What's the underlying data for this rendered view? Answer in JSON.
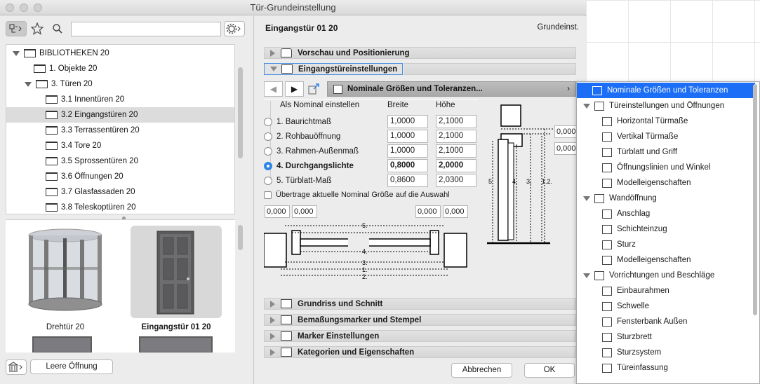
{
  "window": {
    "title": "Tür-Grundeinstellung"
  },
  "toolbar": {
    "search_value": ""
  },
  "tree": [
    {
      "label": "BIBLIOTHEKEN 20",
      "level": 0,
      "expanded": true
    },
    {
      "label": "1. Objekte 20",
      "level": 1
    },
    {
      "label": "3. Türen 20",
      "level": 1,
      "expanded": true
    },
    {
      "label": "3.1 Innentüren 20",
      "level": 2
    },
    {
      "label": "3.2 Eingangstüren 20",
      "level": 2,
      "selected": true
    },
    {
      "label": "3.3 Terrassentüren 20",
      "level": 2
    },
    {
      "label": "3.4 Tore 20",
      "level": 2
    },
    {
      "label": "3.5 Sprossentüren 20",
      "level": 2
    },
    {
      "label": "3.6 Öffnungen 20",
      "level": 2
    },
    {
      "label": "3.7 Glasfassaden 20",
      "level": 2
    },
    {
      "label": "3.8 Teleskoptüren 20",
      "level": 2
    }
  ],
  "thumbs": [
    {
      "label": "Drehtür 20",
      "selected": false
    },
    {
      "label": "Eingangstür 01 20",
      "selected": true
    }
  ],
  "bottom_left": {
    "button": "Leere Öffnung"
  },
  "header": {
    "title": "Eingangstür 01 20",
    "right": "Grundeinst."
  },
  "sections_top": [
    {
      "label": "Vorschau und Positionierung",
      "open": false
    },
    {
      "label": "Eingangstüreinstellungen",
      "open": true
    }
  ],
  "combo": {
    "label": "Nominale Größen und Toleranzen..."
  },
  "nominal": {
    "heading": "Als Nominal einstellen",
    "col_width": "Breite",
    "col_height": "Höhe",
    "rows": [
      {
        "label": "1. Baurichtmaß",
        "width": "1,0000",
        "height": "2,1000",
        "selected": false
      },
      {
        "label": "2. Rohbauöffnung",
        "width": "1,0000",
        "height": "2,1000",
        "selected": false
      },
      {
        "label": "3. Rahmen-Außenmaß",
        "width": "1,0000",
        "height": "2,1000",
        "selected": false
      },
      {
        "label": "4. Durchgangslichte",
        "width": "0,8000",
        "height": "2,0000",
        "selected": true
      },
      {
        "label": "5. Türblatt-Maß",
        "width": "0,8600",
        "height": "2,0300",
        "selected": false
      }
    ],
    "checkbox": "Übertrage aktuelle Nominal Größe auf die Auswahl"
  },
  "tolerances": {
    "left1": "0,000",
    "left2": "0,000",
    "right1": "0,000",
    "right2": "0,000",
    "side1": "0,000",
    "side2": "0,000"
  },
  "diagram_labels": {
    "l5": "5.",
    "l4": "4.",
    "l3": "3.",
    "l1": "1.",
    "l2": "2.",
    "v5": "5.",
    "v4": "4.",
    "v3": "3.",
    "v12": "1.2."
  },
  "sections_bottom": [
    {
      "label": "Grundriss und Schnitt"
    },
    {
      "label": "Bemaßungsmarker und Stempel"
    },
    {
      "label": "Marker Einstellungen"
    },
    {
      "label": "Kategorien und Eigenschaften"
    }
  ],
  "buttons": {
    "cancel": "Abbrechen",
    "ok": "OK"
  },
  "menu": [
    {
      "label": "Nominale Größen und Toleranzen",
      "level": 0,
      "highlighted": true,
      "icon": "nominal-size-icon"
    },
    {
      "label": "Türeinstellungen und Öffnungen",
      "level": 0,
      "group": true,
      "icon": "door-settings-icon"
    },
    {
      "label": "Horizontal Türmaße",
      "level": 1,
      "icon": "horizontal-dimension-icon"
    },
    {
      "label": "Vertikal Türmaße",
      "level": 1,
      "icon": "vertical-dimension-icon"
    },
    {
      "label": "Türblatt und Griff",
      "level": 1,
      "icon": "door-leaf-icon"
    },
    {
      "label": "Öffnungslinien und Winkel",
      "level": 1,
      "icon": "opening-line-icon"
    },
    {
      "label": "Modelleigenschaften",
      "level": 1,
      "icon": "model-properties-icon"
    },
    {
      "label": "Wandöffnung",
      "level": 0,
      "group": true,
      "icon": "wall-opening-icon"
    },
    {
      "label": "Anschlag",
      "level": 1,
      "icon": "stop-icon"
    },
    {
      "label": "Schichteinzug",
      "level": 1,
      "icon": "layer-icon"
    },
    {
      "label": "Sturz",
      "level": 1,
      "icon": "lintel-icon"
    },
    {
      "label": "Modelleigenschaften",
      "level": 1,
      "icon": "model-properties-icon"
    },
    {
      "label": "Vorrichtungen und Beschläge",
      "level": 0,
      "group": true,
      "icon": "fittings-icon"
    },
    {
      "label": "Einbaurahmen",
      "level": 1,
      "icon": "frame-icon"
    },
    {
      "label": "Schwelle",
      "level": 1,
      "icon": "threshold-icon"
    },
    {
      "label": "Fensterbank Außen",
      "level": 1,
      "icon": "sill-icon"
    },
    {
      "label": "Sturzbrett",
      "level": 1,
      "icon": "lintel-board-icon"
    },
    {
      "label": "Sturzsystem",
      "level": 1,
      "icon": "lintel-system-icon"
    },
    {
      "label": "Türeinfassung",
      "level": 1,
      "icon": "casing-icon"
    }
  ]
}
